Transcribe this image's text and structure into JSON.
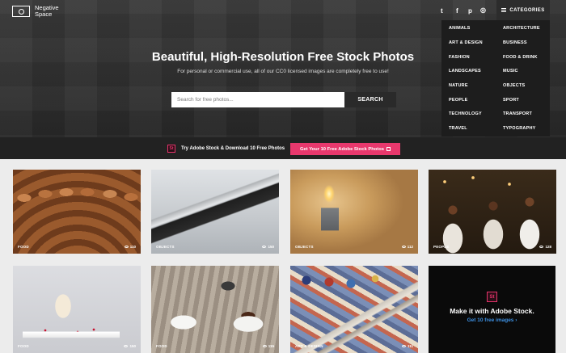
{
  "brand": {
    "logo_line1": "Negative",
    "logo_line2": "Space"
  },
  "social": [
    {
      "icon": "twitter-icon",
      "glyph": "t"
    },
    {
      "icon": "facebook-icon",
      "glyph": "f"
    },
    {
      "icon": "pinterest-icon",
      "glyph": "p"
    },
    {
      "icon": "instagram-icon",
      "glyph": "◎"
    }
  ],
  "categories_button": {
    "label": "CATEGORIES"
  },
  "categories": [
    "ANIMALS",
    "ARCHITECTURE",
    "ART & DESIGN",
    "BUSINESS",
    "FASHION",
    "FOOD & DRINK",
    "LANDSCAPES",
    "MUSIC",
    "NATURE",
    "OBJECTS",
    "PEOPLE",
    "SPORT",
    "TECHNOLOGY",
    "TRANSPORT",
    "TRAVEL",
    "TYPOGRAPHY"
  ],
  "hero": {
    "title": "Beautiful, High-Resolution Free Stock Photos",
    "subtitle": "For personal or commercial use, all of our CC0 licensed images are completely free to use!"
  },
  "search": {
    "placeholder": "Search for free photos...",
    "button": "SEARCH"
  },
  "promo": {
    "badge": "St",
    "text": "Try Adobe Stock & Download 10 Free Photos",
    "button": "Get Your 10 Free Adobe Stock Photos"
  },
  "photos": [
    {
      "category": "FOOD",
      "views": "110"
    },
    {
      "category": "OBJECTS",
      "views": "150"
    },
    {
      "category": "OBJECTS",
      "views": "112"
    },
    {
      "category": "PEOPLE",
      "views": "128"
    },
    {
      "category": "FOOD",
      "views": "150"
    },
    {
      "category": "FOOD",
      "views": "115"
    },
    {
      "category": "ART & DESIGN",
      "views": "111"
    }
  ],
  "ad": {
    "badge": "St",
    "title": "Make it with Adobe Stock.",
    "link": "Get 10 free images ›"
  },
  "colors": {
    "accent": "#e8386d",
    "link": "#3d8fe0",
    "hero_bg": "#333333"
  }
}
